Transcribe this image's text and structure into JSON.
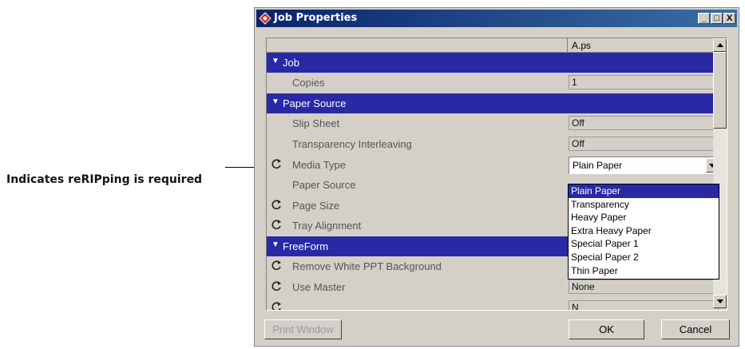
{
  "callout": {
    "text": "Indicates reRIPping is required"
  },
  "window": {
    "title": "Job Properties",
    "controls": {
      "minimize": "_",
      "maximize": "□",
      "close": "X"
    }
  },
  "grid": {
    "file_column": "A.ps",
    "sections": [
      {
        "label": "Job"
      },
      {
        "label": "Paper Source"
      },
      {
        "label": "FreeForm"
      }
    ],
    "items": [
      {
        "label": "Copies",
        "value": "1",
        "rerip": false
      },
      {
        "label": "Slip Sheet",
        "value": "Off",
        "rerip": false
      },
      {
        "label": "Transparency Interleaving",
        "value": "Off",
        "rerip": false
      },
      {
        "label": "Media Type",
        "value": "Plain Paper",
        "rerip": true
      },
      {
        "label": "Paper Source",
        "value": "",
        "rerip": false
      },
      {
        "label": "Page Size",
        "value": "",
        "rerip": true
      },
      {
        "label": "Tray Alignment",
        "value": "",
        "rerip": true
      },
      {
        "label": "Remove White PPT Background",
        "value": "",
        "rerip": true
      },
      {
        "label": "Use Master",
        "value": "None",
        "rerip": true
      },
      {
        "label": "",
        "value": "N",
        "rerip": true
      }
    ]
  },
  "media_type_options": [
    "Plain Paper",
    "Transparency",
    "Heavy Paper",
    "Extra Heavy Paper",
    "Special Paper 1",
    "Special Paper 2",
    "Thin Paper"
  ],
  "media_type_selected": "Plain Paper",
  "buttons": {
    "print_window": "Print Window",
    "ok": "OK",
    "cancel": "Cancel"
  },
  "colors": {
    "section_bar": "#2929a6",
    "title_bar": "#0a246a",
    "dialog_bg": "#d4d0c8"
  }
}
